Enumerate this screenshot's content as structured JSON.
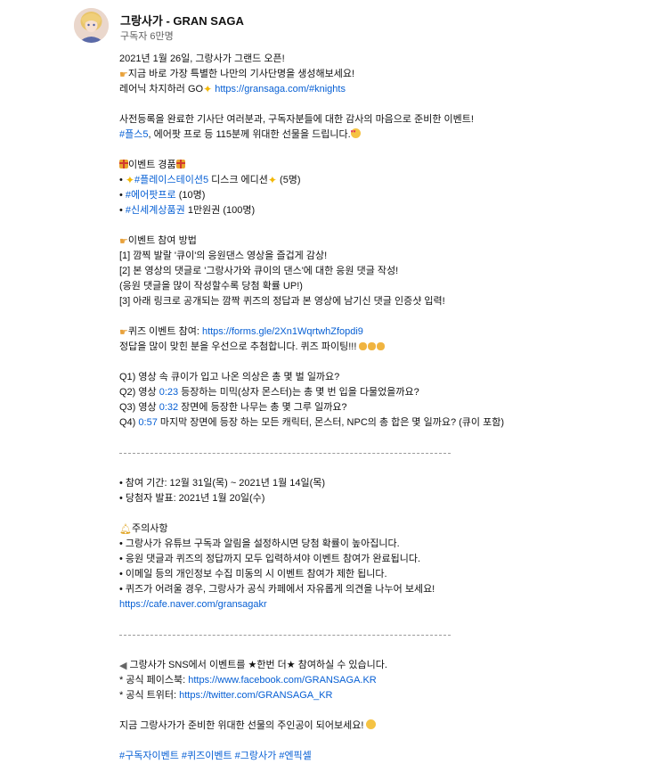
{
  "channel": {
    "name": "그랑사가 - GRAN SAGA",
    "subscribers": "구독자 6만명"
  },
  "description": {
    "l1": "2021년 1월 26일, 그랑사가 그랜드 오픈!",
    "l2": "지금 바로 가장 특별한 나만의 기사단명을 생성해보세요!",
    "l3_text": "레어닉 차지하러 GO",
    "l3_link": "https://gransaga.com/#knights",
    "l4": "사전등록을 완료한 기사단 여러분과, 구독자분들에 대한 감사의 마음으로 준비한 이벤트!",
    "l5_tag": "#플스5",
    "l5_text": ", 에어팟 프로 등 115분께 위대한 선물을 드립니다.",
    "prize_title": "이벤트 경품",
    "prize1_tag": "#플레이스테이션5",
    "prize1_text": " 디스크 에디션",
    "prize1_count": " (5명)",
    "prize2_tag": "#에어팟프로",
    "prize2_text": " (10명)",
    "prize3_tag": "#신세계상품권",
    "prize3_text": " 1만원권 (100명)",
    "how_title": "이벤트 참여 방법",
    "how1": "[1] 깜찍 발랄 '큐이'의 응원댄스 영상을 즐겁게 감상!",
    "how2": "[2] 본 영상의 댓글로 '그랑사가와 큐이의 댄스'에 대한 응원 댓글 작성!",
    "how3": "(응원 댓글을 많이 작성할수록 당첨 확률 UP!)",
    "how4": "[3] 아래 링크로 공개되는 깜짝 퀴즈의 정답과 본 영상에 남기신 댓글 인증샷 입력!",
    "quiz_label": "퀴즈 이벤트 참여: ",
    "quiz_link": "https://forms.gle/2Xn1WqrtwhZfopdi9",
    "quiz_note": "정답을 많이 맞힌 분을 우선으로 추첨합니다. 퀴즈 파이팅!!! ",
    "q1": "Q1) 영상 속 큐이가 입고 나온 의상은 총 몇 벌 일까요?",
    "q2_pre": "Q2) 영상 ",
    "q2_time": "0:23",
    "q2_post": " 등장하는 미믹(상자 몬스터)는 총 몇 번 입을 다물었을까요?",
    "q3_pre": "Q3) 영상 ",
    "q3_time": "0:32",
    "q3_post": " 장면에 등장한 나무는 총 몇 그루 일까요?",
    "q4_pre": "Q4) ",
    "q4_time": "0:57",
    "q4_post": " 마지막 장면에 등장 하는 모든 캐릭터, 몬스터, NPC의 총 합은 몇 일까요? (큐이 포함)",
    "period": "• 참여 기간: 12월 31일(목) ~ 2021년 1월 14일(목)",
    "announce": "• 당첨자 발표:  2021년 1월 20일(수)",
    "notice_title": "주의사항",
    "n1": "• 그랑사가 유튜브 구독과 알림을 설정하시면 당첨 확률이 높아집니다.",
    "n2": "• 응원 댓글과 퀴즈의 정답까지 모두 입력하셔야 이벤트 참여가 완료됩니다.",
    "n3": "• 이메일 등의 개인정보 수집 미동의 시 이벤트 참여가 제한 됩니다.",
    "n4": "• 퀴즈가 어려울 경우, 그랑사가 공식 카페에서 자유롭게 의견을 나누어 보세요!",
    "cafe_link": "https://cafe.naver.com/gransagakr",
    "sns": " 그랑사가 SNS에서 이벤트를 ★한번 더★ 참여하실 수 있습니다.",
    "fb_label": "* 공식 페이스북: ",
    "fb_link": "https://www.facebook.com/GRANSAGA.KR",
    "tw_label": "* 공식 트위터: ",
    "tw_link": "https://twitter.com/GRANSAGA_KR",
    "closing": "지금 그랑사가가 준비한 위대한 선물의 주인공이 되어보세요! ",
    "hashtags": "#구독자이벤트 #퀴즈이벤트 #그랑사가 #엔픽셀"
  }
}
